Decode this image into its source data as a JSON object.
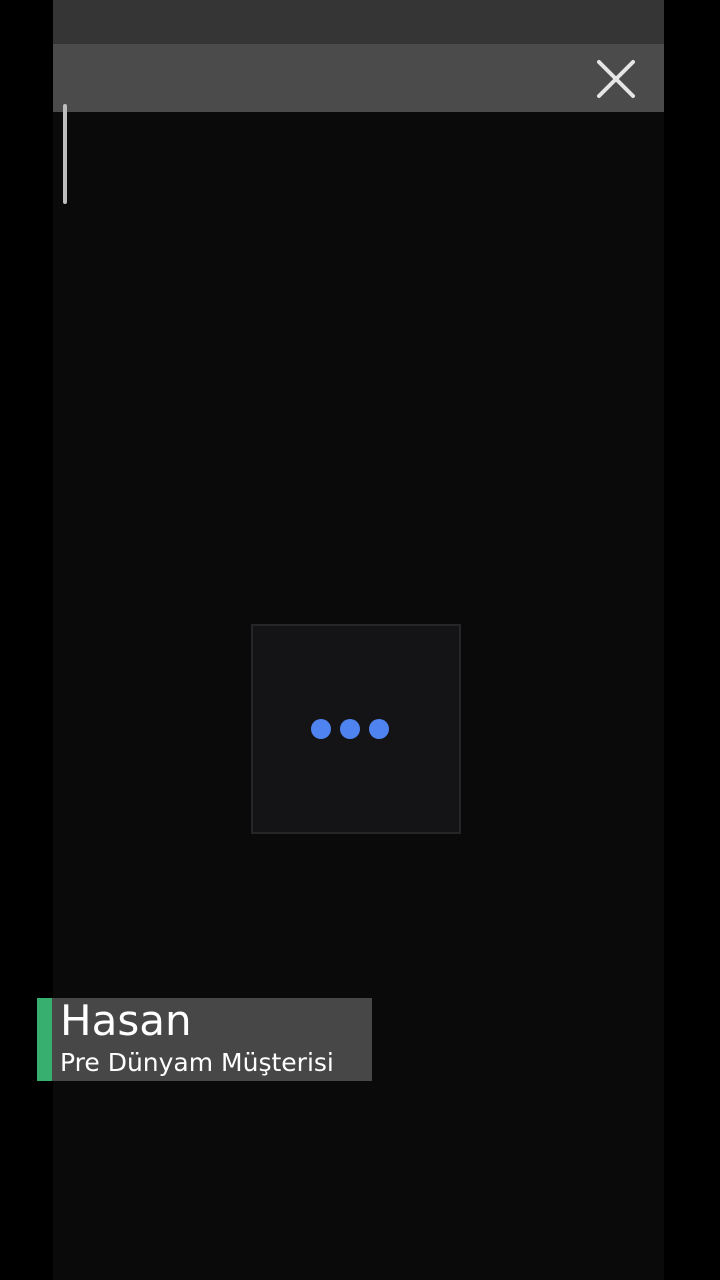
{
  "player": {
    "close_icon": "close-icon",
    "loading_indicator": "three-dots-loading",
    "accent_color": "#37b06f",
    "loader_dot_color": "#4f84f0"
  },
  "caption": {
    "name": "Hasan",
    "subtitle": "Pre Dünyam Müşterisi"
  }
}
